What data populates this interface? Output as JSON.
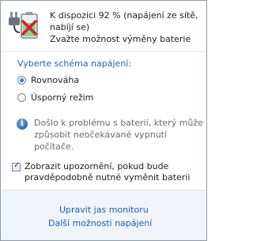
{
  "status": {
    "icon": "battery-warning-icon",
    "lines": [
      "K dispozici 92 % (napájení ze sítě,",
      "nabíjí se)",
      "Zvažte možnost výměny baterie"
    ]
  },
  "plans": {
    "title": "Vyberte schéma napájení:",
    "items": [
      {
        "label": "Rovnováha",
        "checked": true
      },
      {
        "label": "Úsporný režim",
        "checked": false
      }
    ]
  },
  "info": {
    "icon": "info-icon",
    "glyph": "i",
    "lines": [
      "Došlo k problému s baterií, který může",
      "způsobit neočekávané vypnutí",
      "počítače."
    ]
  },
  "notify": {
    "checked": true,
    "lines": [
      "Zobrazit upozornění, pokud bude",
      "pravděpodobně nutné vyměnit baterii"
    ]
  },
  "links": {
    "brightness": "Upravit jas monitoru",
    "more": "Další možnosti napájení"
  },
  "colors": {
    "link": "#1a5dbc",
    "section_title": "#2f5f9a",
    "footer_bg": "#f0f4f9"
  }
}
